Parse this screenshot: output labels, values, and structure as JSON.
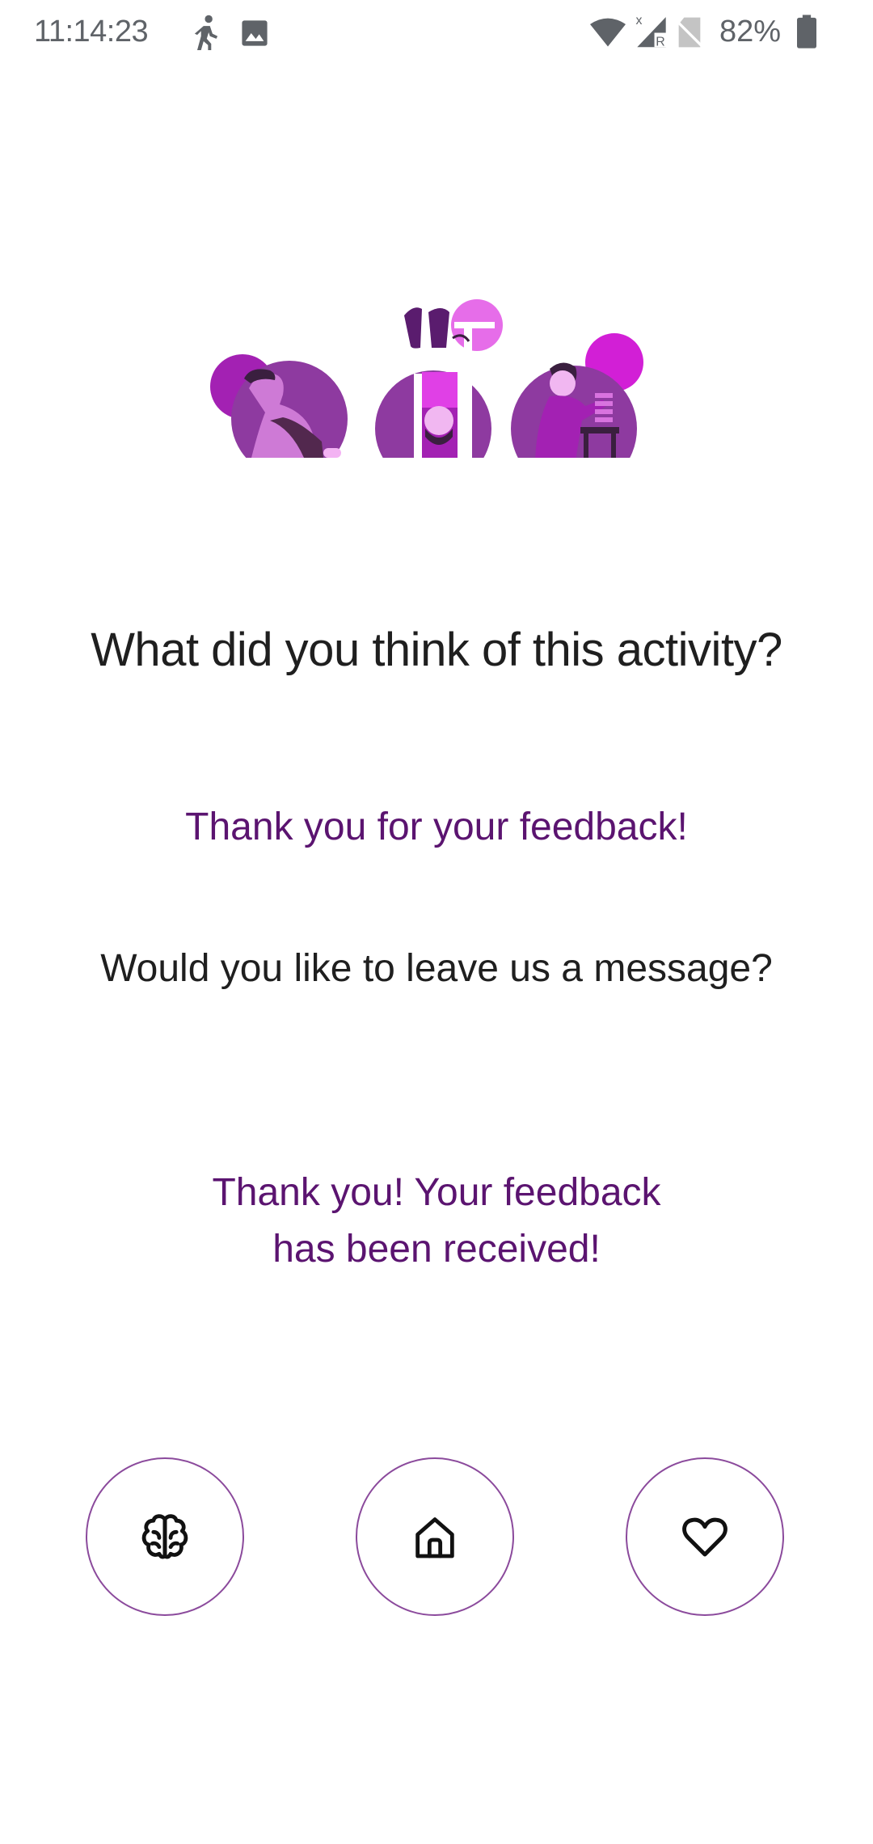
{
  "status_bar": {
    "time": "11:14:23",
    "battery_percent": "82%",
    "icons": [
      "walking-icon",
      "image-icon",
      "wifi-icon",
      "signal-icon",
      "no-sim-icon",
      "battery-icon"
    ]
  },
  "content": {
    "question": "What did you think of this activity?",
    "thanks": "Thank you for your feedback!",
    "leave_message": "Would you like to leave us a message?",
    "received_line1": "Thank you! Your feedback",
    "received_line2": "has been received!"
  },
  "bottom_nav": {
    "buttons": [
      {
        "icon": "brain-icon"
      },
      {
        "icon": "home-icon"
      },
      {
        "icon": "heart-icon"
      }
    ]
  },
  "colors": {
    "accent": "#5b1470",
    "button_border": "#8b4a9c",
    "illustration_purple": "#8e3aa0",
    "illustration_magenta": "#d21fd6"
  }
}
